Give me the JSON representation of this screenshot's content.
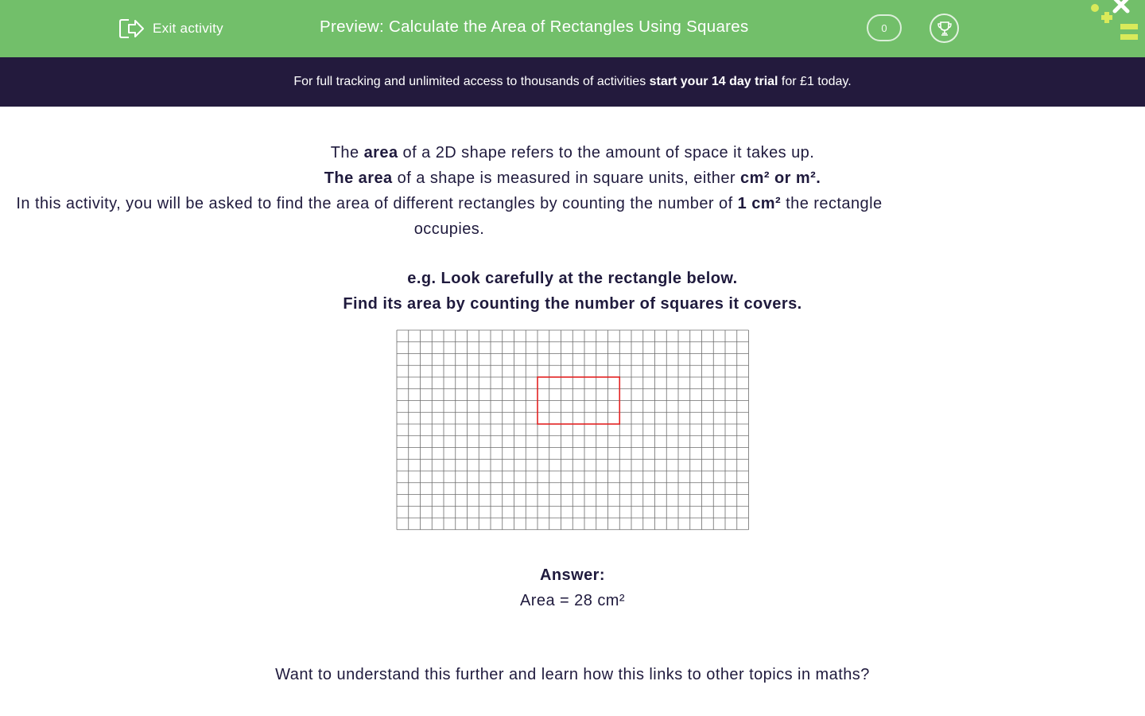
{
  "header": {
    "exit_label": "Exit activity",
    "title": "Preview: Calculate the Area of Rectangles Using Squares",
    "score": "0",
    "brand_color": "#72bf6a"
  },
  "banner": {
    "text_before": "For full tracking and unlimited access to thousands of activities ",
    "text_bold": "start your 14 day trial",
    "text_after": " for £1 today.",
    "background": "#231a3d"
  },
  "intro": {
    "line1": {
      "a": "The ",
      "b": "area",
      "c": " of a 2D shape refers to the amount of space it takes up."
    },
    "line2": {
      "a": "The area",
      "b": " of a shape is measured in square units, either ",
      "c": "cm² or m²."
    },
    "line3": {
      "a": "In this activity, you will be asked to find the area of different rectangles by counting the number of ",
      "b": "1 cm²",
      "c": " the rectangle occupies."
    }
  },
  "example": {
    "line1": "e.g. Look carefully at the rectangle below.",
    "line2": "Find its area by counting the number of squares it covers."
  },
  "grid": {
    "columns": 30,
    "rows": 17,
    "rectangle": {
      "col": 12,
      "row": 4,
      "width": 7,
      "height": 4,
      "color": "#e32222"
    }
  },
  "answer": {
    "label": "Answer:",
    "value": "Area = 28 cm²"
  },
  "further": "Want to understand this further and learn how this links to other topics in maths?"
}
